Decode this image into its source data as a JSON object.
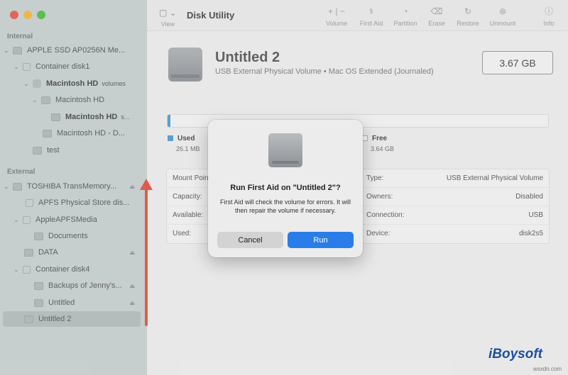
{
  "app": {
    "title": "Disk Utility"
  },
  "sidebar": {
    "internal_label": "Internal",
    "external_label": "External",
    "items": [
      {
        "label": "APPLE SSD AP0256N Me..."
      },
      {
        "label": "Container disk1"
      },
      {
        "label": "Macintosh HD",
        "extra": "volumes"
      },
      {
        "label": "Macintosh HD"
      },
      {
        "label": "Macintosh HD",
        "extra": "s..."
      },
      {
        "label": "Macintosh HD - D..."
      },
      {
        "label": "test"
      },
      {
        "label": "TOSHIBA TransMemory..."
      },
      {
        "label": "APFS Physical Store dis..."
      },
      {
        "label": "AppleAPFSMedia"
      },
      {
        "label": "Documents"
      },
      {
        "label": "DATA"
      },
      {
        "label": "Container disk4"
      },
      {
        "label": "Backups of Jenny's..."
      },
      {
        "label": "Untitled"
      },
      {
        "label": "Untitled 2"
      }
    ]
  },
  "toolbar": {
    "view_label": "View",
    "buttons": [
      {
        "label": "Volume",
        "icon": "plus-minus-icon"
      },
      {
        "label": "First Aid",
        "icon": "stethoscope-icon"
      },
      {
        "label": "Partition",
        "icon": "partition-icon"
      },
      {
        "label": "Erase",
        "icon": "erase-icon"
      },
      {
        "label": "Restore",
        "icon": "restore-icon"
      },
      {
        "label": "Unmount",
        "icon": "unmount-icon"
      },
      {
        "label": "Info",
        "icon": "info-icon"
      }
    ]
  },
  "volume": {
    "name": "Untitled 2",
    "subtitle": "USB External Physical Volume • Mac OS Extended (Journaled)",
    "capacity": "3.67 GB",
    "used_label": "Used",
    "used_value": "26.1 MB",
    "free_label": "Free",
    "free_value": "3.64 GB",
    "used_fraction": 0.007
  },
  "info": {
    "left": [
      {
        "key": "Mount Point:"
      },
      {
        "key": "Capacity:"
      },
      {
        "key": "Available:"
      },
      {
        "key": "Used:"
      }
    ],
    "right": [
      {
        "key": "Type:",
        "value": "USB External Physical Volume"
      },
      {
        "key": "Owners:",
        "value": "Disabled"
      },
      {
        "key": "Connection:",
        "value": "USB"
      },
      {
        "key": "Device:",
        "value": "disk2s5"
      }
    ]
  },
  "dialog": {
    "title": "Run First Aid on \"Untitled 2\"?",
    "message": "First Aid will check the volume for errors. It will then repair the volume if necessary.",
    "cancel_label": "Cancel",
    "run_label": "Run"
  },
  "watermark": {
    "brand": "iBoysoft",
    "site": "wsxdn.com"
  },
  "colors": {
    "accent": "#2a7de8",
    "used": "#5aa9d6",
    "arrow": "#e25b4a"
  }
}
